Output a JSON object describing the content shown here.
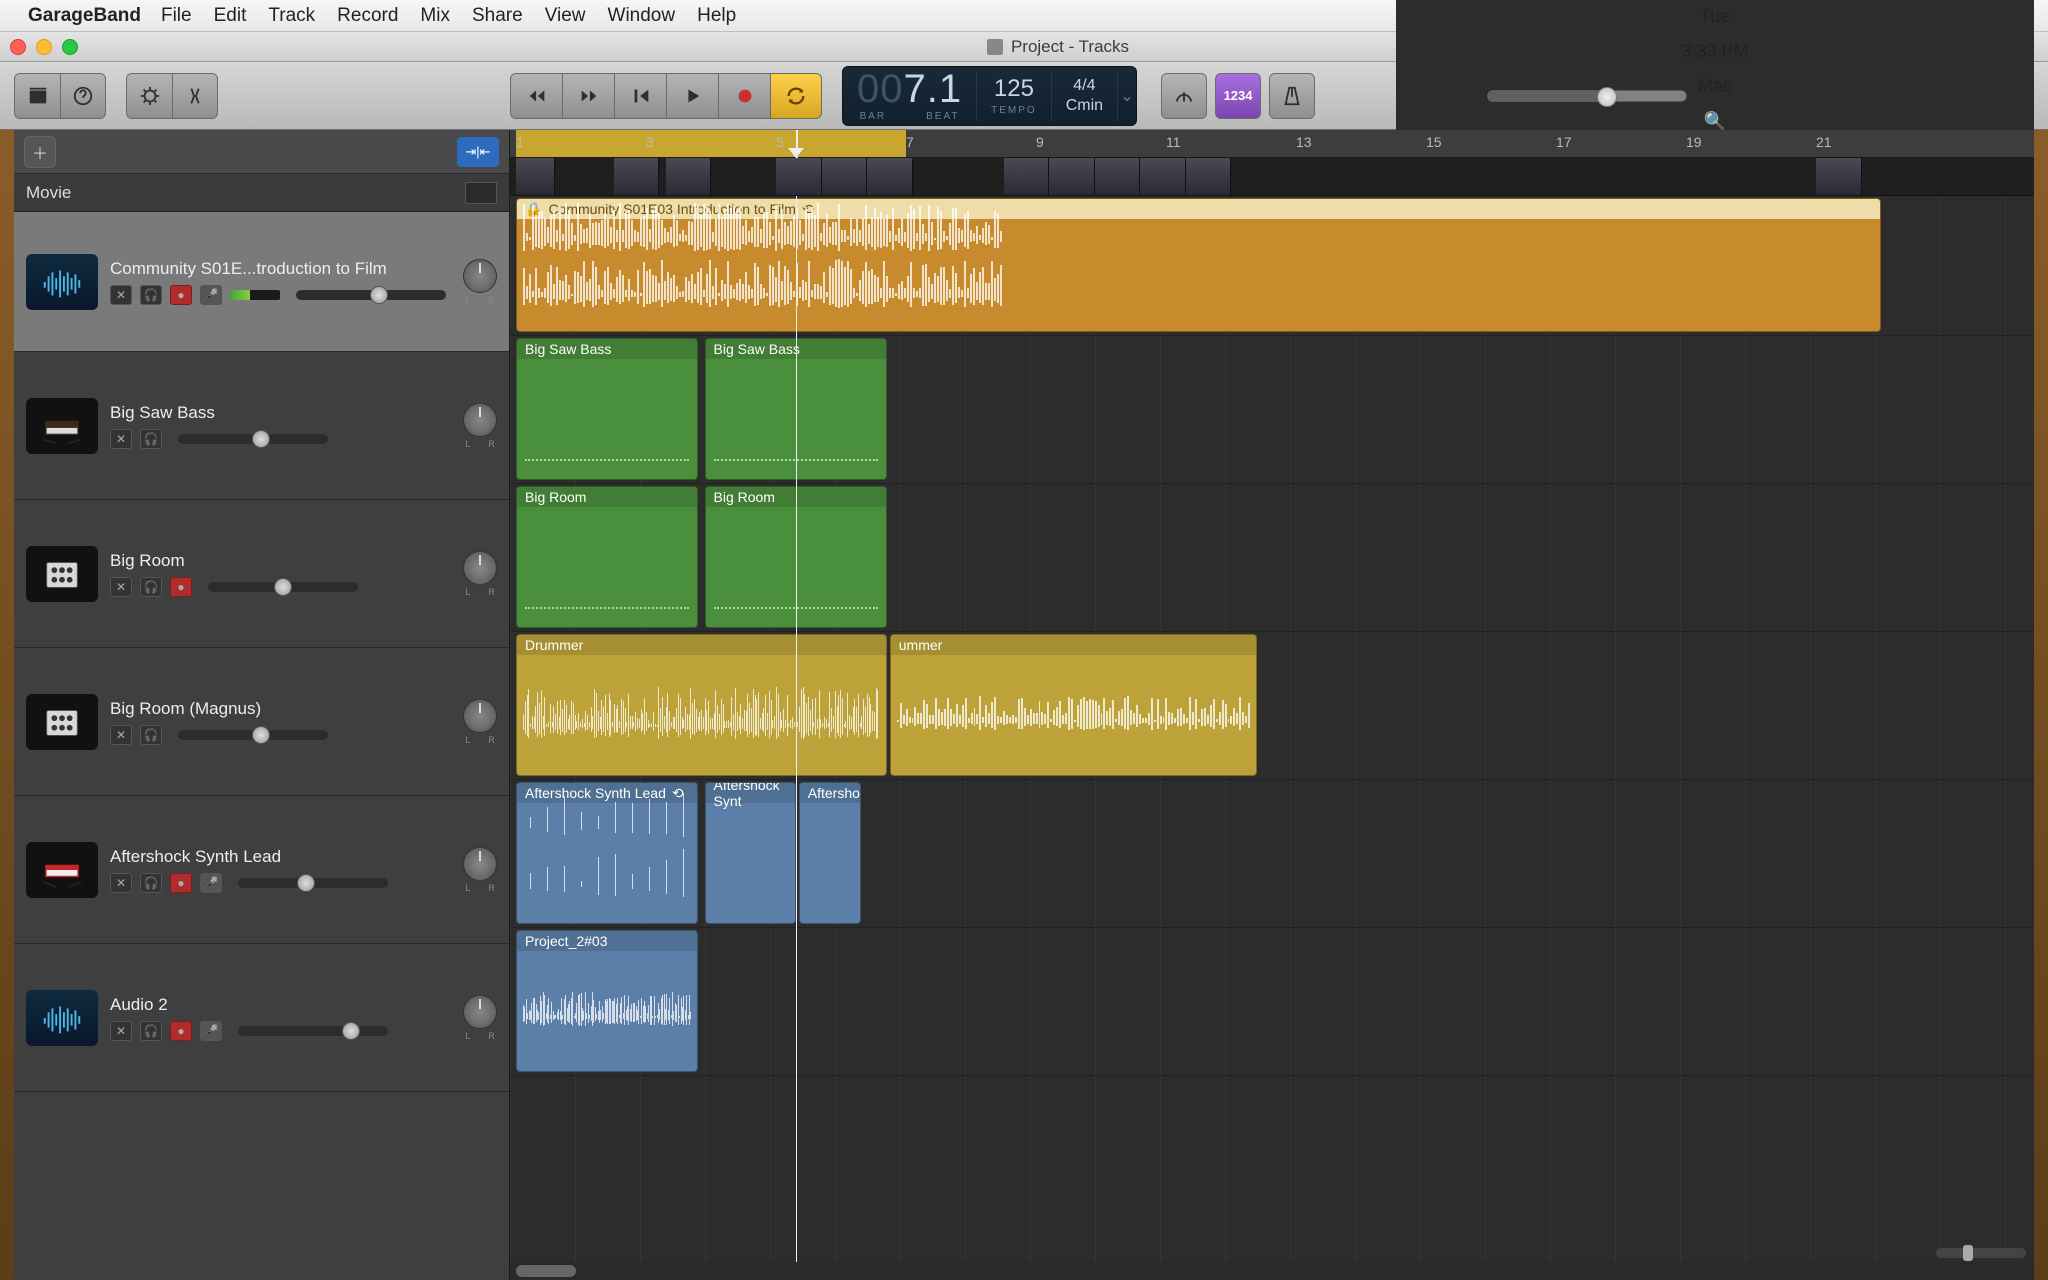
{
  "menubar": {
    "app": "GarageBand",
    "items": [
      "File",
      "Edit",
      "Track",
      "Record",
      "Mix",
      "Share",
      "View",
      "Window",
      "Help"
    ],
    "right": {
      "day": "Tue",
      "time": "3:33 PM",
      "user": "Mac"
    }
  },
  "window": {
    "title": "Project - Tracks"
  },
  "lcd": {
    "bar_prefix": "00",
    "bar": "7",
    "beat": "1",
    "bar_label": "BAR",
    "beat_label": "BEAT",
    "tempo": "125",
    "tempo_label": "TEMPO",
    "sig": "4/4",
    "key": "Cmin"
  },
  "toolbar": {
    "count_in": "1234"
  },
  "ruler": {
    "bars": [
      1,
      3,
      5,
      7,
      9,
      11,
      13,
      15,
      17,
      19,
      21
    ],
    "pxPerBar": 65,
    "cycleStartBar": 1,
    "cycleEndBar": 7,
    "playheadBar": 5.3
  },
  "movieRow": {
    "label": "Movie"
  },
  "tracks": [
    {
      "name": "Community S01E...troduction to Film",
      "icon": "wave",
      "selected": true,
      "rec": true,
      "input": true,
      "vol": 55,
      "meter": true
    },
    {
      "name": "Big Saw Bass",
      "icon": "synth",
      "selected": false,
      "rec": false,
      "input": false,
      "vol": 55
    },
    {
      "name": "Big Room",
      "icon": "drum",
      "selected": false,
      "rec": true,
      "input": false,
      "vol": 50
    },
    {
      "name": "Big Room (Magnus)",
      "icon": "drum",
      "selected": false,
      "rec": false,
      "input": false,
      "vol": 55
    },
    {
      "name": "Aftershock Synth Lead",
      "icon": "keys",
      "selected": false,
      "rec": true,
      "input": true,
      "vol": 45
    },
    {
      "name": "Audio 2",
      "icon": "wave",
      "selected": false,
      "rec": true,
      "input": true,
      "vol": 75
    }
  ],
  "laneHeights": [
    140,
    148,
    148,
    148,
    148,
    148
  ],
  "regions": [
    {
      "lane": 0,
      "startBar": 1,
      "endBar": 22,
      "color": "orange",
      "label": "Community S01E03 Introduction to Film",
      "lock": true,
      "loop": true,
      "wave": "stereo"
    },
    {
      "lane": 1,
      "startBar": 1,
      "endBar": 3.8,
      "color": "green",
      "label": "Big Saw Bass"
    },
    {
      "lane": 1,
      "startBar": 3.9,
      "endBar": 6.7,
      "color": "green",
      "label": "Big Saw Bass"
    },
    {
      "lane": 2,
      "startBar": 1,
      "endBar": 3.8,
      "color": "green",
      "label": "Big Room"
    },
    {
      "lane": 2,
      "startBar": 3.9,
      "endBar": 6.7,
      "color": "green",
      "label": "Big Room"
    },
    {
      "lane": 3,
      "startBar": 1,
      "endBar": 6.7,
      "color": "yellow",
      "label": "Drummer",
      "wave": "mono-dense"
    },
    {
      "lane": 3,
      "startBar": 6.75,
      "endBar": 12.4,
      "color": "yellow",
      "label": "ummer",
      "wave": "mono-sparse"
    },
    {
      "lane": 4,
      "startBar": 1,
      "endBar": 3.8,
      "color": "blue",
      "label": "Aftershock Synth Lead",
      "loop": true,
      "wave": "stereo"
    },
    {
      "lane": 4,
      "startBar": 3.9,
      "endBar": 5.3,
      "color": "blue",
      "label": "Aftershock Synt",
      "wave": "stereo"
    },
    {
      "lane": 4,
      "startBar": 5.35,
      "endBar": 6.3,
      "color": "blue",
      "label": "Aftershock",
      "wave": "stereo"
    },
    {
      "lane": 5,
      "startBar": 1,
      "endBar": 3.8,
      "color": "blue",
      "label": "Project_2#03",
      "wave": "mono-sparse"
    }
  ],
  "filmstrip": [
    {
      "start": 1,
      "w": 0.6
    },
    {
      "start": 2.5,
      "w": 0.7
    },
    {
      "start": 3.3,
      "w": 0.7
    },
    {
      "start": 5,
      "w": 0.7
    },
    {
      "start": 5.7,
      "w": 0.7
    },
    {
      "start": 6.4,
      "w": 0.7
    },
    {
      "start": 8.5,
      "w": 0.7
    },
    {
      "start": 9.2,
      "w": 0.7
    },
    {
      "start": 9.9,
      "w": 0.7
    },
    {
      "start": 10.6,
      "w": 0.7
    },
    {
      "start": 11.3,
      "w": 0.7
    },
    {
      "start": 21,
      "w": 0.7
    }
  ]
}
